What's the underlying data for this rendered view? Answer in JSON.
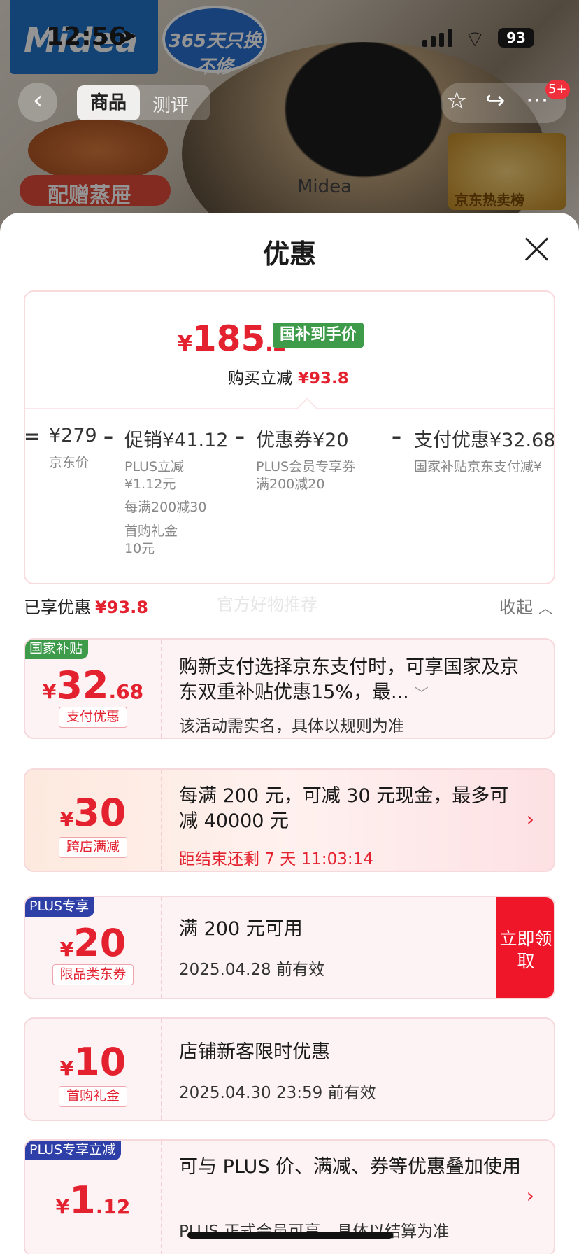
{
  "background": {
    "brand": "Midea",
    "badge": "365天只换不修",
    "gift": "配赠蒸屉",
    "product_logo": "Midea",
    "hot_list": "京东热卖榜"
  },
  "status_bar": {
    "time": "12:56",
    "battery": "93"
  },
  "top_nav": {
    "tab_active": "商品",
    "tab_2": "测评",
    "badge": "5+"
  },
  "sheet": {
    "title": "优惠",
    "price": {
      "yen": "¥",
      "integer": "185",
      "decimal": ".2",
      "tag": "国补到手价",
      "reduce_label": "购买立减",
      "reduce_value": "¥93.8"
    },
    "breakdown": [
      {
        "op": "=",
        "head": "¥279",
        "subs": [
          "京东价"
        ]
      },
      {
        "op": "–",
        "head": "促销¥41.12",
        "subs": [
          "PLUS立减",
          "¥1.12元",
          "每满200减30",
          "首购礼金",
          "10元"
        ]
      },
      {
        "op": "–",
        "head": "优惠券¥20",
        "subs": [
          "PLUS会员专享券",
          "满200减20"
        ]
      },
      {
        "op": "–",
        "head": "支付优惠¥32.68",
        "subs": [
          "国家补贴京东支付减¥"
        ]
      }
    ],
    "enjoyed": {
      "label": "已享优惠",
      "value": "¥93.8"
    },
    "watermark": "官方好物推荐",
    "collapse": "收起"
  },
  "coupons": [
    {
      "corner": "国家补贴",
      "corner_color": "#3d9b4a",
      "yen": "¥",
      "big": "32",
      "small": ".68",
      "label": "支付优惠",
      "title": "购新支付选择京东支付时，可享国家及京东双重补贴优惠15%，最...",
      "sub": "该活动需实名，具体以规则为准"
    },
    {
      "yen": "¥",
      "big": "30",
      "label": "跨店满减",
      "title": "每满 200 元，可减 30 元现金，最多可减 40000 元",
      "sub": "距结束还剩 7 天 11:03:14"
    },
    {
      "corner": "PLUS专享",
      "corner_color": "#2f3fa8",
      "yen": "¥",
      "big": "20",
      "label": "限品类东券",
      "title": "满 200 元可用",
      "sub": "2025.04.28 前有效",
      "claim": "立即领取"
    },
    {
      "yen": "¥",
      "big": "10",
      "label": "首购礼金",
      "title": "店铺新客限时优惠",
      "sub": "2025.04.30 23:59 前有效"
    },
    {
      "corner": "PLUS专享立减",
      "corner_color": "#2f3fa8",
      "yen": "¥",
      "big": "1",
      "small": ".12",
      "title": "可与 PLUS 价、满减、券等优惠叠加使用",
      "sub": "PLUS 正式会员可享，具体以结算为准"
    }
  ],
  "colors": {
    "accent_red": "#e4212f",
    "green_tag": "#3d9b4a",
    "plus_blue": "#2f3fa8"
  }
}
